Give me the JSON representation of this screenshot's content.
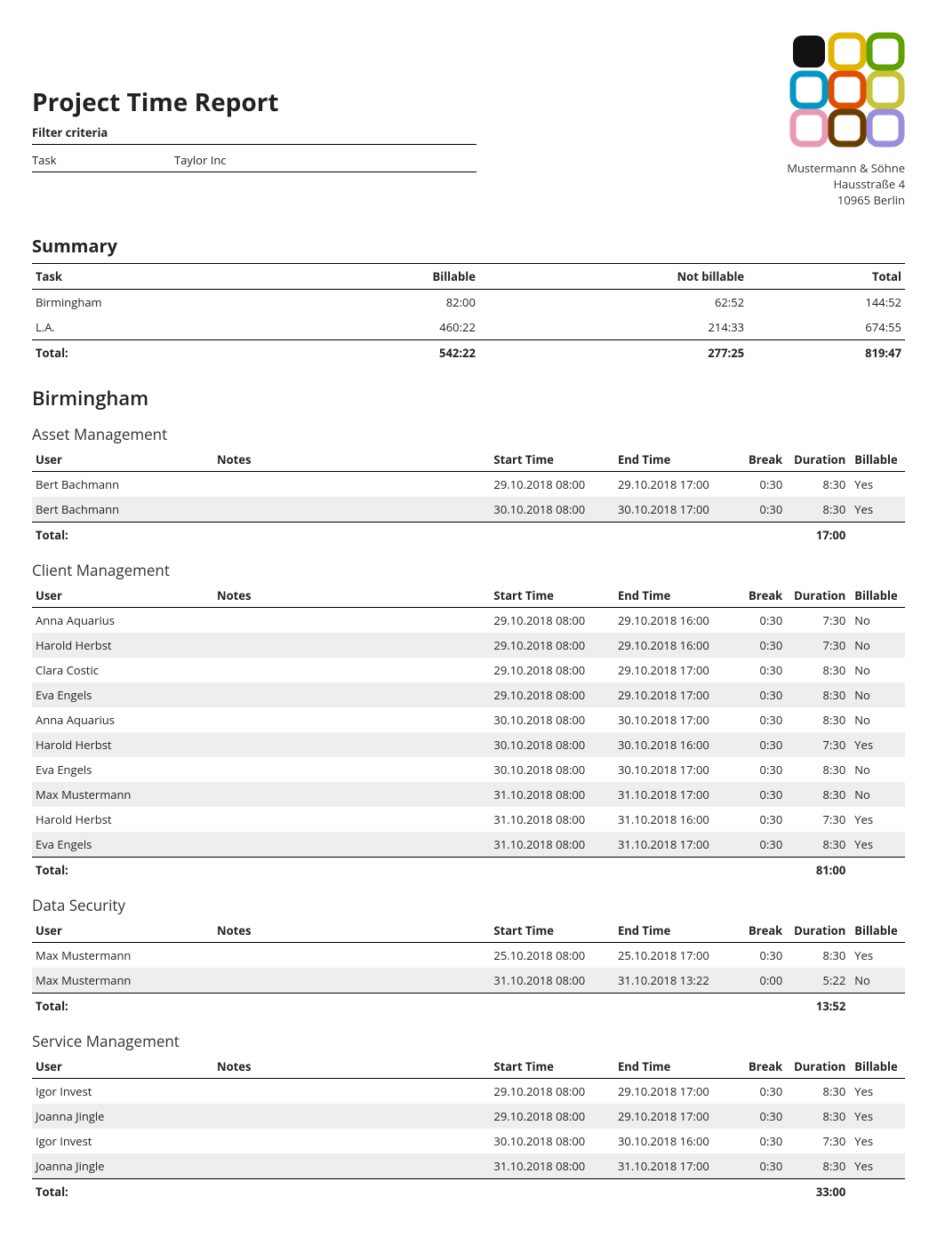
{
  "title": "Project Time Report",
  "company": {
    "name": "Mustermann & Söhne",
    "street": "Hausstraße 4",
    "city": "10965 Berlin"
  },
  "filter": {
    "heading": "Filter criteria",
    "key": "Task",
    "value": "Taylor Inc"
  },
  "summary": {
    "heading": "Summary",
    "cols": {
      "task": "Task",
      "billable": "Billable",
      "notbillable": "Not billable",
      "total": "Total"
    },
    "rows": [
      {
        "task": "Birmingham",
        "billable": "82:00",
        "notbillable": "62:52",
        "total": "144:52"
      },
      {
        "task": "L.A.",
        "billable": "460:22",
        "notbillable": "214:33",
        "total": "674:55"
      }
    ],
    "footer": {
      "label": "Total:",
      "billable": "542:22",
      "notbillable": "277:25",
      "total": "819:47"
    }
  },
  "detailCols": {
    "user": "User",
    "notes": "Notes",
    "start": "Start Time",
    "end": "End Time",
    "break": "Break",
    "duration": "Duration",
    "billable": "Billable"
  },
  "totalLabel": "Total:",
  "projects": [
    {
      "name": "Birmingham",
      "tasks": [
        {
          "name": "Asset Management",
          "total": "17:00",
          "rows": [
            {
              "user": "Bert Bachmann",
              "notes": "",
              "start": "29.10.2018 08:00",
              "end": "29.10.2018 17:00",
              "break": "0:30",
              "dur": "8:30",
              "bill": "Yes"
            },
            {
              "user": "Bert Bachmann",
              "notes": "",
              "start": "30.10.2018 08:00",
              "end": "30.10.2018 17:00",
              "break": "0:30",
              "dur": "8:30",
              "bill": "Yes"
            }
          ]
        },
        {
          "name": "Client Management",
          "total": "81:00",
          "rows": [
            {
              "user": "Anna Aquarius",
              "notes": "",
              "start": "29.10.2018 08:00",
              "end": "29.10.2018 16:00",
              "break": "0:30",
              "dur": "7:30",
              "bill": "No"
            },
            {
              "user": "Harold Herbst",
              "notes": "",
              "start": "29.10.2018 08:00",
              "end": "29.10.2018 16:00",
              "break": "0:30",
              "dur": "7:30",
              "bill": "No"
            },
            {
              "user": "Clara Costic",
              "notes": "",
              "start": "29.10.2018 08:00",
              "end": "29.10.2018 17:00",
              "break": "0:30",
              "dur": "8:30",
              "bill": "No"
            },
            {
              "user": "Eva Engels",
              "notes": "",
              "start": "29.10.2018 08:00",
              "end": "29.10.2018 17:00",
              "break": "0:30",
              "dur": "8:30",
              "bill": "No"
            },
            {
              "user": "Anna Aquarius",
              "notes": "",
              "start": "30.10.2018 08:00",
              "end": "30.10.2018 17:00",
              "break": "0:30",
              "dur": "8:30",
              "bill": "No"
            },
            {
              "user": "Harold Herbst",
              "notes": "",
              "start": "30.10.2018 08:00",
              "end": "30.10.2018 16:00",
              "break": "0:30",
              "dur": "7:30",
              "bill": "Yes"
            },
            {
              "user": "Eva Engels",
              "notes": "",
              "start": "30.10.2018 08:00",
              "end": "30.10.2018 17:00",
              "break": "0:30",
              "dur": "8:30",
              "bill": "No"
            },
            {
              "user": "Max Mustermann",
              "notes": "",
              "start": "31.10.2018 08:00",
              "end": "31.10.2018 17:00",
              "break": "0:30",
              "dur": "8:30",
              "bill": "No"
            },
            {
              "user": "Harold Herbst",
              "notes": "",
              "start": "31.10.2018 08:00",
              "end": "31.10.2018 16:00",
              "break": "0:30",
              "dur": "7:30",
              "bill": "Yes"
            },
            {
              "user": "Eva Engels",
              "notes": "",
              "start": "31.10.2018 08:00",
              "end": "31.10.2018 17:00",
              "break": "0:30",
              "dur": "8:30",
              "bill": "Yes"
            }
          ]
        },
        {
          "name": "Data Security",
          "total": "13:52",
          "rows": [
            {
              "user": "Max Mustermann",
              "notes": "",
              "start": "25.10.2018 08:00",
              "end": "25.10.2018 17:00",
              "break": "0:30",
              "dur": "8:30",
              "bill": "Yes"
            },
            {
              "user": "Max Mustermann",
              "notes": "",
              "start": "31.10.2018 08:00",
              "end": "31.10.2018 13:22",
              "break": "0:00",
              "dur": "5:22",
              "bill": "No"
            }
          ]
        },
        {
          "name": "Service Management",
          "total": "33:00",
          "rows": [
            {
              "user": "Igor Invest",
              "notes": "",
              "start": "29.10.2018 08:00",
              "end": "29.10.2018 17:00",
              "break": "0:30",
              "dur": "8:30",
              "bill": "Yes"
            },
            {
              "user": "Joanna Jingle",
              "notes": "",
              "start": "29.10.2018 08:00",
              "end": "29.10.2018 17:00",
              "break": "0:30",
              "dur": "8:30",
              "bill": "Yes"
            },
            {
              "user": "Igor Invest",
              "notes": "",
              "start": "30.10.2018 08:00",
              "end": "30.10.2018 16:00",
              "break": "0:30",
              "dur": "7:30",
              "bill": "Yes"
            },
            {
              "user": "Joanna Jingle",
              "notes": "",
              "start": "31.10.2018 08:00",
              "end": "31.10.2018 17:00",
              "break": "0:30",
              "dur": "8:30",
              "bill": "Yes"
            }
          ]
        }
      ]
    }
  ]
}
